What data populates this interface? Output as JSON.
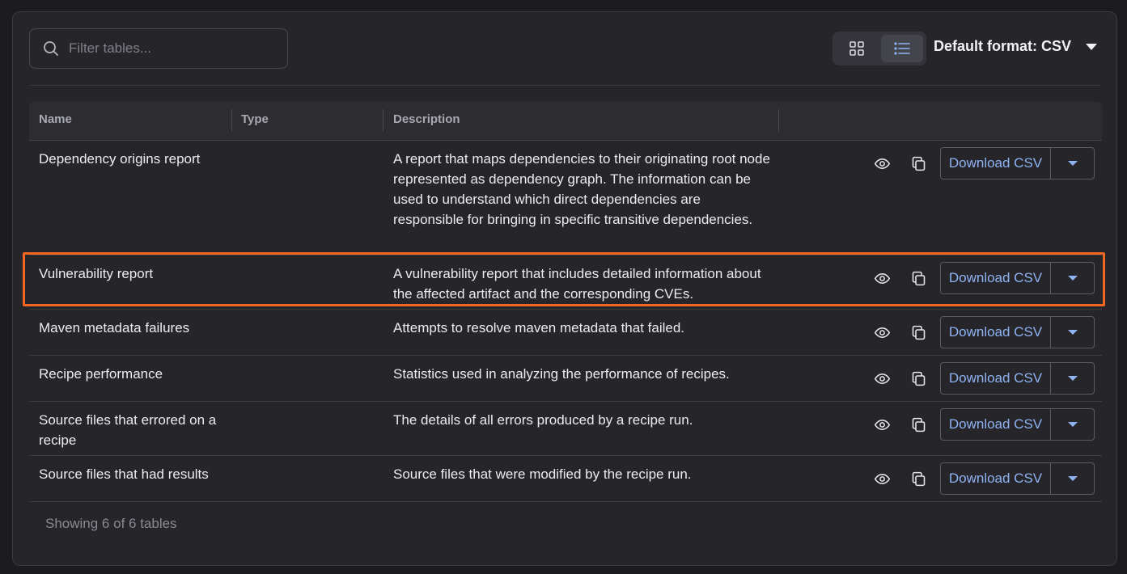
{
  "search": {
    "placeholder": "Filter tables..."
  },
  "view_toggle": {
    "options": [
      "grid-view",
      "list-view"
    ],
    "active": "list-view"
  },
  "format": {
    "label": "Default format: CSV"
  },
  "table": {
    "columns": [
      "Name",
      "Type",
      "Description",
      ""
    ],
    "rows": [
      {
        "name": "Dependency origins report",
        "type": "",
        "description": "A report that maps dependencies to their originating root node represented as dependency graph. The information can be used to understand which direct dependencies are responsible for bringing in specific transitive dependencies.",
        "download_label": "Download CSV"
      },
      {
        "name": "Vulnerability report",
        "type": "",
        "description": "A vulnerability report that includes detailed information about the affected artifact and the corresponding CVEs.",
        "download_label": "Download CSV",
        "highlighted": true
      },
      {
        "name": "Maven metadata failures",
        "type": "",
        "description": "Attempts to resolve maven metadata that failed.",
        "download_label": "Download CSV"
      },
      {
        "name": "Recipe performance",
        "type": "",
        "description": "Statistics used in analyzing the performance of recipes.",
        "download_label": "Download CSV"
      },
      {
        "name": "Source files that errored on a recipe",
        "type": "",
        "description": "The details of all errors produced by a recipe run.",
        "download_label": "Download CSV"
      },
      {
        "name": "Source files that had results",
        "type": "",
        "description": "Source files that were modified by the recipe run.",
        "download_label": "Download CSV"
      }
    ]
  },
  "footer": {
    "text": "Showing 6 of 6 tables"
  },
  "colors": {
    "accent": "#8fb3f2",
    "highlight": "#f26522",
    "background": "#25252a"
  }
}
